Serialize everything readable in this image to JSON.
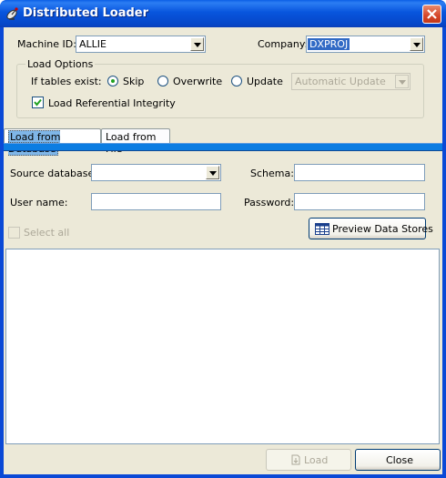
{
  "window": {
    "title": "Distributed Loader",
    "icon": "satellite-dish-icon",
    "close_icon": "close-icon"
  },
  "top": {
    "machine_label": "Machine ID:",
    "machine_value": "ALLIE",
    "company_label": "Company:",
    "company_value": "DXPROJ"
  },
  "load_options": {
    "group_label": "Load Options",
    "if_tables_label": "If tables exist:",
    "skip_label": "Skip",
    "overwrite_label": "Overwrite",
    "update_label": "Update",
    "update_mode_value": "Automatic Update",
    "ref_integrity_label": "Load Referential Integrity",
    "selected_option": "Skip",
    "ref_integrity_checked": true
  },
  "tabs": [
    {
      "label": "Load from Database",
      "active": true
    },
    {
      "label": "Load from File",
      "active": false
    }
  ],
  "database_tab": {
    "source_label": "Source database:",
    "source_value": "",
    "schema_label": "Schema:",
    "schema_value": "",
    "user_label": "User name:",
    "user_value": "",
    "password_label": "Password:",
    "password_value": "",
    "select_all_label": "Select all",
    "preview_label": "Preview Data Stores",
    "preview_icon": "table-grid-icon"
  },
  "footer": {
    "load_label": "Load",
    "load_icon": "load-icon",
    "close_label": "Close"
  },
  "colors": {
    "titlebar": "#0855dd",
    "client_bg": "#ece9d8",
    "tab_strip": "#0c7de2",
    "selection": "#316ac5",
    "close_button": "#d5462a"
  }
}
